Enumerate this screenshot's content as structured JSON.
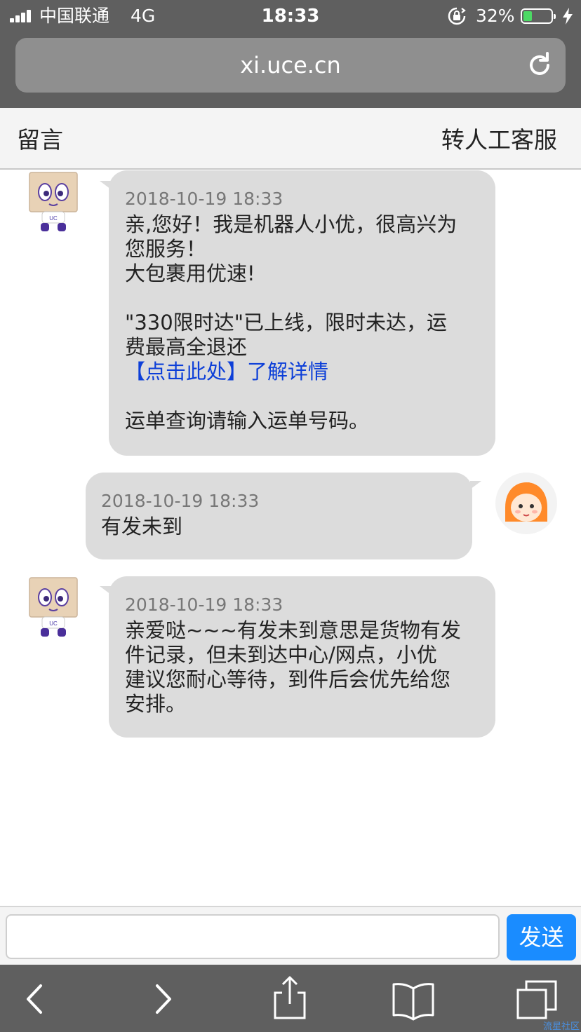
{
  "status_bar": {
    "carrier": "中国联通",
    "network": "4G",
    "time": "18:33",
    "battery": "32%",
    "battery_level": 0.32
  },
  "browser": {
    "url": "xi.uce.cn"
  },
  "header": {
    "left_label": "留言",
    "right_label": "转人工客服"
  },
  "messages": [
    {
      "sender": "bot",
      "timestamp": "2018-10-19 18:33",
      "lines": [
        "亲,您好！我是机器人小优，很高兴为",
        "您服务！",
        "大包裹用优速!"
      ],
      "lines2": [
        "\"330限时达\"已上线，限时未达，运",
        "费最高全退还"
      ],
      "link": "【点击此处】了解详情",
      "footer": "运单查询请输入运单号码。"
    },
    {
      "sender": "user",
      "timestamp": "2018-10-19 18:33",
      "text": "有发未到"
    },
    {
      "sender": "bot",
      "timestamp": "2018-10-19 18:33",
      "lines": [
        "亲爱哒~~~有发未到意思是货物有发",
        "件记录，但未到达中心/网点，小优",
        "建议您耐心等待，到件后会优先给您",
        "安排。"
      ]
    }
  ],
  "input": {
    "value": "",
    "send_label": "发送"
  },
  "toolbar": {
    "icons": [
      "back-icon",
      "forward-icon",
      "share-icon",
      "bookmarks-icon",
      "tabs-icon"
    ]
  },
  "watermark": "流星社区",
  "colors": {
    "chrome": "#5f5f5f",
    "bubble": "#dcdcdc",
    "link": "#0d3fd8",
    "send_button": "#1a8cff",
    "battery_fill": "#4cd964"
  }
}
